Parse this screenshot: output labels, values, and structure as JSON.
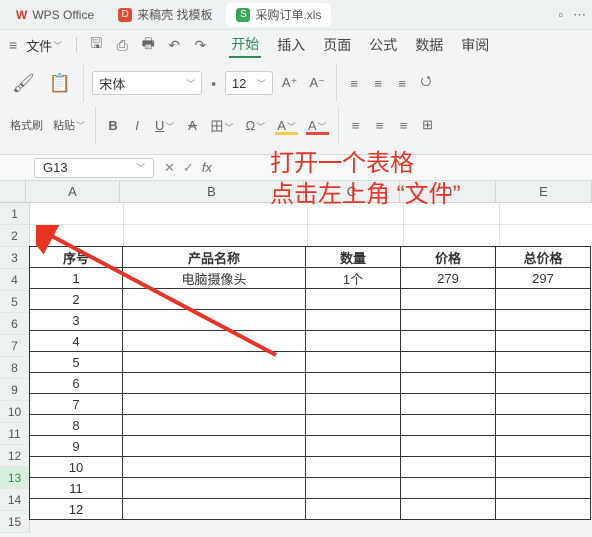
{
  "title_tabs": {
    "wps": "WPS Office",
    "laodaoke": "来稿壳 找模板",
    "file": "采购订单.xls"
  },
  "menu": {
    "file": "文件",
    "tabs": [
      "开始",
      "插入",
      "页面",
      "公式",
      "数据",
      "审阅"
    ]
  },
  "ribbon": {
    "format_painter": "格式刷",
    "paste": "粘贴",
    "font_name": "宋体",
    "font_size": "12",
    "a_plus": "A⁺",
    "a_minus": "A⁻",
    "buttons": [
      "B",
      "I",
      "U",
      "A",
      "田",
      "Ω"
    ],
    "font_color": "A",
    "highlight": "A"
  },
  "refbar": {
    "cell": "G13",
    "fx": "fx"
  },
  "columns": [
    "A",
    "B",
    "C",
    "D",
    "E"
  ],
  "row_numbers": [
    1,
    2,
    3,
    4,
    5,
    6,
    7,
    8,
    9,
    10,
    11,
    12,
    13,
    14,
    15
  ],
  "selected_row": 13,
  "table": {
    "headers": [
      "序号",
      "产品名称",
      "数量",
      "价格",
      "总价格"
    ],
    "rows": [
      {
        "a": "1",
        "b": "电脑摄像头",
        "c": "1个",
        "d": "279",
        "e": "297"
      },
      {
        "a": "2",
        "b": "",
        "c": "",
        "d": "",
        "e": ""
      },
      {
        "a": "3",
        "b": "",
        "c": "",
        "d": "",
        "e": ""
      },
      {
        "a": "4",
        "b": "",
        "c": "",
        "d": "",
        "e": ""
      },
      {
        "a": "5",
        "b": "",
        "c": "",
        "d": "",
        "e": ""
      },
      {
        "a": "6",
        "b": "",
        "c": "",
        "d": "",
        "e": ""
      },
      {
        "a": "7",
        "b": "",
        "c": "",
        "d": "",
        "e": ""
      },
      {
        "a": "8",
        "b": "",
        "c": "",
        "d": "",
        "e": ""
      },
      {
        "a": "9",
        "b": "",
        "c": "",
        "d": "",
        "e": ""
      },
      {
        "a": "10",
        "b": "",
        "c": "",
        "d": "",
        "e": ""
      },
      {
        "a": "11",
        "b": "",
        "c": "",
        "d": "",
        "e": ""
      },
      {
        "a": "12",
        "b": "",
        "c": "",
        "d": "",
        "e": ""
      }
    ]
  },
  "annotation": {
    "line1": "打开一个表格",
    "line2_a": "点击左上角",
    "line2_b": "“文件”"
  }
}
